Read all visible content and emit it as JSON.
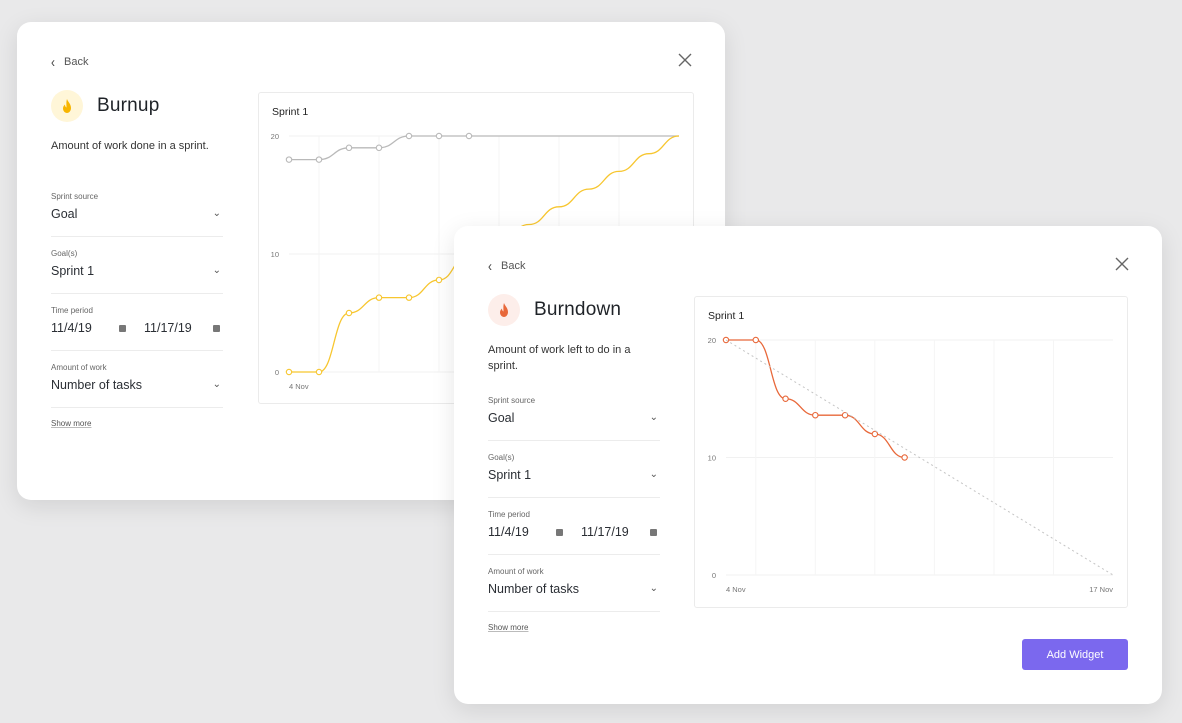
{
  "burnup": {
    "back_label": "Back",
    "title": "Burnup",
    "description": "Amount of work done in a sprint.",
    "fields": {
      "sprint_source": {
        "label": "Sprint source",
        "value": "Goal"
      },
      "goals": {
        "label": "Goal(s)",
        "value": "Sprint 1"
      },
      "time_period": {
        "label": "Time period",
        "start": "11/4/19",
        "end": "11/17/19"
      },
      "amount_of_work": {
        "label": "Amount of work",
        "value": "Number of tasks"
      }
    },
    "show_more": "Show more",
    "accent_color": "#f7c62f",
    "icon_bg": "#fff6d8"
  },
  "burndown": {
    "back_label": "Back",
    "title": "Burndown",
    "description": "Amount of work left to do in a sprint.",
    "fields": {
      "sprint_source": {
        "label": "Sprint source",
        "value": "Goal"
      },
      "goals": {
        "label": "Goal(s)",
        "value": "Sprint 1"
      },
      "time_period": {
        "label": "Time period",
        "start": "11/4/19",
        "end": "11/17/19"
      },
      "amount_of_work": {
        "label": "Amount of work",
        "value": "Number of tasks"
      }
    },
    "show_more": "Show more",
    "add_widget_label": "Add Widget",
    "accent_color": "#e8683a",
    "icon_bg": "#fdeeea",
    "button_color": "#7b68ee"
  },
  "chart_data": [
    {
      "type": "line",
      "title": "Sprint 1",
      "x": [
        0,
        1,
        2,
        3,
        4,
        5,
        6,
        7,
        8,
        9,
        10,
        11,
        12,
        13
      ],
      "x_tick_labels": [
        "4 Nov"
      ],
      "y_ticks": [
        "0",
        "10",
        "20"
      ],
      "ylim": [
        0,
        20
      ],
      "series": [
        {
          "values": [
            18,
            18,
            19,
            19,
            20,
            20,
            20,
            20,
            20,
            20,
            20,
            20,
            20,
            20
          ],
          "color": "#b9b9b9"
        },
        {
          "values": [
            0,
            0,
            5,
            6.3,
            6.3,
            7.8,
            10,
            11,
            12.5,
            14,
            15.5,
            17,
            18.5,
            20
          ],
          "color": "#f7c62f"
        }
      ],
      "grid": true
    },
    {
      "type": "line",
      "title": "Sprint 1",
      "x": [
        0,
        1,
        2,
        3,
        4,
        5,
        6,
        7,
        8,
        9,
        10,
        11,
        12,
        13
      ],
      "x_tick_labels": [
        "4 Nov",
        "17 Nov"
      ],
      "y_ticks": [
        "0",
        "10",
        "20"
      ],
      "ylim": [
        0,
        20
      ],
      "series": [
        {
          "values": [
            20,
            20,
            15,
            13.6,
            13.6,
            12,
            10
          ],
          "color": "#e8683a"
        },
        {
          "values": [
            20,
            0
          ],
          "x": [
            0,
            13
          ],
          "color": "#c4c4c4",
          "style": "dotted"
        }
      ],
      "grid": true
    }
  ]
}
